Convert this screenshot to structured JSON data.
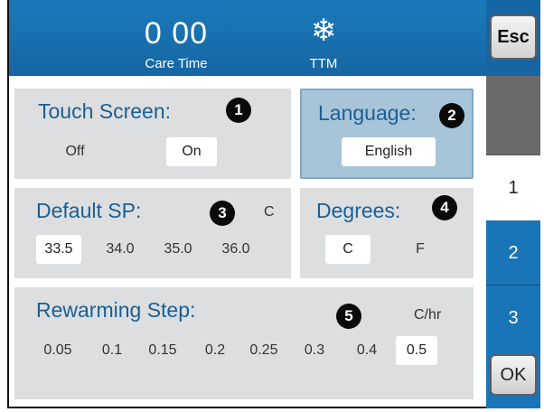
{
  "header": {
    "care_time_value": "0 00",
    "care_time_label": "Care Time",
    "mode_icon": "snowflake-icon",
    "mode_label": "TTM",
    "esc_label": "Esc",
    "color": "#1a6fae"
  },
  "panels": {
    "touch_screen": {
      "title": "Touch Screen:",
      "badge": "1",
      "options": [
        "Off",
        "On"
      ],
      "selected": "On"
    },
    "language": {
      "title": "Language:",
      "badge": "2",
      "value": "English"
    },
    "default_sp": {
      "title": "Default SP:",
      "badge": "3",
      "unit": "C",
      "options": [
        "33.5",
        "34.0",
        "35.0",
        "36.0"
      ],
      "selected": "33.5"
    },
    "degrees": {
      "title": "Degrees:",
      "badge": "4",
      "options": [
        "C",
        "F"
      ],
      "selected": "C"
    },
    "rewarming_step": {
      "title": "Rewarming Step:",
      "badge": "5",
      "unit": "C/hr",
      "options": [
        "0.05",
        "0.1",
        "0.15",
        "0.2",
        "0.25",
        "0.3",
        "0.4",
        "0.5"
      ],
      "selected": "0.5"
    }
  },
  "side_tabs": {
    "tab1": "1",
    "tab2": "2",
    "tab3": "3",
    "active": "1",
    "ok_label": "OK"
  },
  "colors": {
    "header_blue": "#1a6fae",
    "tab_blue": "#1a74b8",
    "panel_gray": "#dcdedf",
    "title_blue": "#1a5f96",
    "language_panel": "#a8c4d8"
  }
}
